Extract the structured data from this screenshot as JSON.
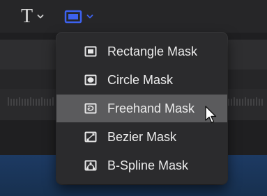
{
  "toolbar": {
    "text_tool_glyph": "T",
    "text_tool_icon": "text-tool-icon",
    "mask_tool_icon": "rectangle-mask-tool-icon",
    "chevron_icon": "chevron-down-icon",
    "accent_color": "#3d62f0"
  },
  "menu": {
    "items": [
      {
        "label": "Rectangle Mask",
        "icon": "rectangle-mask-icon"
      },
      {
        "label": "Circle Mask",
        "icon": "circle-mask-icon"
      },
      {
        "label": "Freehand Mask",
        "icon": "freehand-mask-icon",
        "highlighted": true
      },
      {
        "label": "Bezier Mask",
        "icon": "bezier-mask-icon"
      },
      {
        "label": "B-Spline Mask",
        "icon": "bspline-mask-icon"
      }
    ]
  },
  "colors": {
    "background": "#1f1f21",
    "menu_background": "#2b2b2d",
    "highlight": "#5b5b5d",
    "menu_text": "#ececec",
    "timeline_blue": "#1d3a63"
  }
}
